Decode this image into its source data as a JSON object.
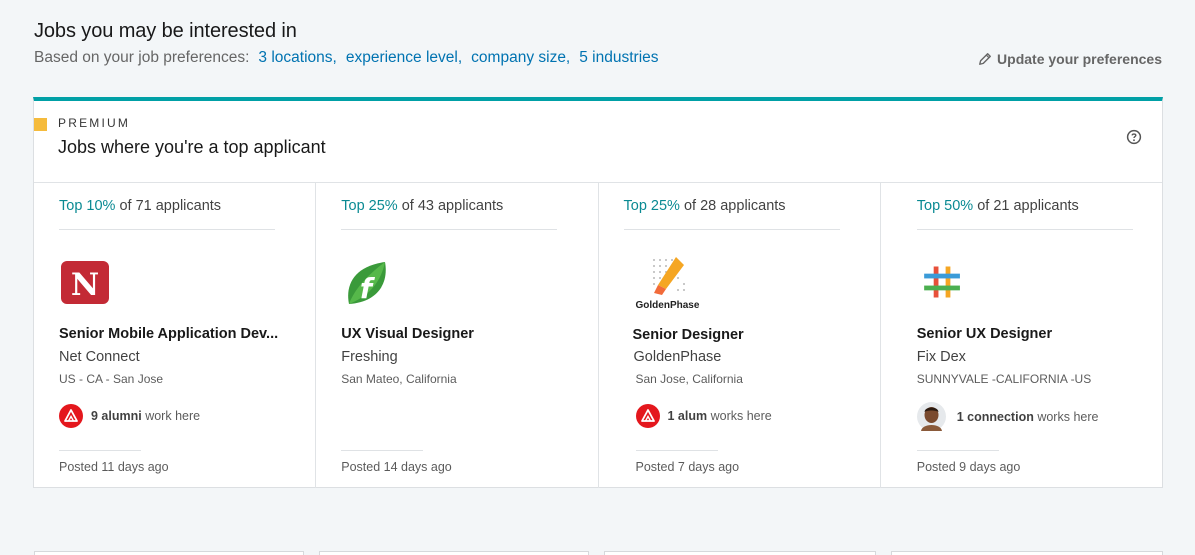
{
  "header": {
    "title": "Jobs you may be interested in",
    "prefs_prefix": "Based on your job preferences:",
    "prefs_links": [
      "3 locations,",
      "experience level,",
      "company size,",
      "5 industries"
    ],
    "update_label": "Update your preferences"
  },
  "premium": {
    "label": "PREMIUM",
    "title": "Jobs where you're a top applicant"
  },
  "jobs": [
    {
      "rank_top": "Top 10%",
      "rank_rest": "of 71 applicants",
      "logo": "netconnect-logo",
      "title": "Senior Mobile Application Dev...",
      "company": "Net Connect",
      "location": "US - CA - San Jose",
      "insight_bold": "9 alumni",
      "insight_rest": "work here",
      "posted": "Posted 11 days ago"
    },
    {
      "rank_top": "Top 25%",
      "rank_rest": "of 43 applicants",
      "logo": "freshing-logo",
      "title": "UX Visual Designer",
      "company": "Freshing",
      "location": "San Mateo, California",
      "insight_bold": "",
      "insight_rest": "",
      "posted": "Posted 14 days ago"
    },
    {
      "rank_top": "Top 25%",
      "rank_rest": "of 28 applicants",
      "logo": "goldenphase-logo",
      "logo_text": "GoldenPhase",
      "title": "Senior Designer",
      "company": "GoldenPhase",
      "location": "San Jose, California",
      "insight_bold": "1 alum",
      "insight_rest": "works here",
      "posted": "Posted 7 days ago"
    },
    {
      "rank_top": "Top 50%",
      "rank_rest": "of 21 applicants",
      "logo": "fixdex-logo",
      "title": "Senior UX Designer",
      "company": "Fix Dex",
      "location": "SUNNYVALE -CALIFORNIA -US",
      "insight_bold": "1 connection",
      "insight_rest": "works here",
      "posted": "Posted 9 days ago"
    }
  ],
  "colors": {
    "accent_teal": "#00a0a6",
    "link_blue": "#0073b1",
    "premium_gold": "#f5bb3c",
    "rank_teal": "#0a8a93",
    "alumni_red": "#e4171d"
  }
}
